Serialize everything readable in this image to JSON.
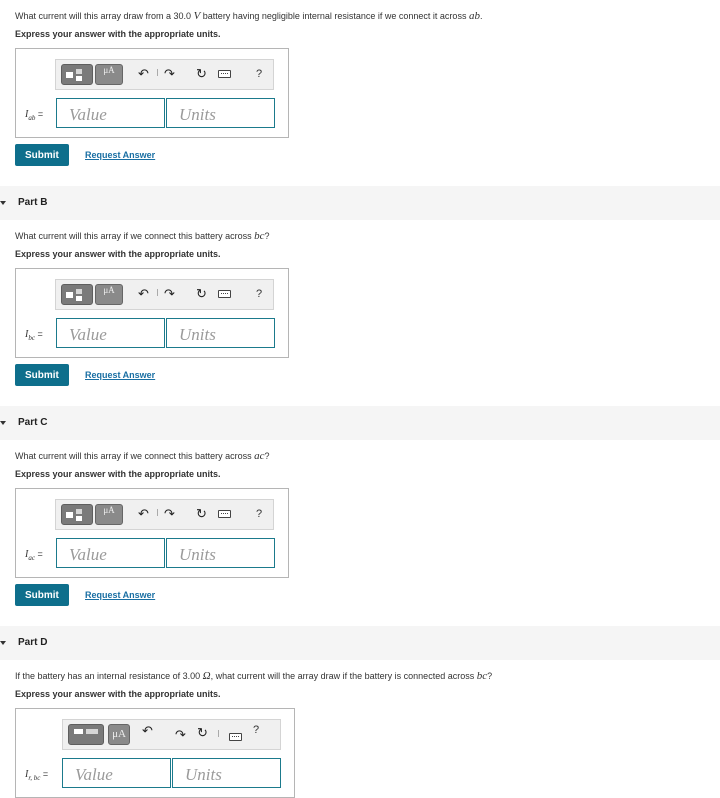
{
  "partA": {
    "question_pre": "What current will this array draw from a 30.0 ",
    "question_unit": "V",
    "question_post": " battery having negligible internal resistance if we connect it across ",
    "question_var": "ab",
    "question_end": ".",
    "instruction": "Express your answer with the appropriate units.",
    "label_main": "I",
    "label_sub": "ab",
    "label_eq": " =",
    "value_placeholder": "Value",
    "units_placeholder": "Units",
    "submit_label": "Submit",
    "request_label": "Request Answer"
  },
  "partB": {
    "header": "Part B",
    "question_pre": "What current will this array if we connect this battery across ",
    "question_var": "bc",
    "question_end": "?",
    "instruction": "Express your answer with the appropriate units.",
    "label_main": "I",
    "label_sub": "bc",
    "label_eq": " =",
    "value_placeholder": "Value",
    "units_placeholder": "Units",
    "submit_label": "Submit",
    "request_label": "Request Answer"
  },
  "partC": {
    "header": "Part C",
    "question_pre": "What current will this array if we connect this battery across ",
    "question_var": "ac",
    "question_end": "?",
    "instruction": "Express your answer with the appropriate units.",
    "label_main": "I",
    "label_sub": "ac",
    "label_eq": " =",
    "value_placeholder": "Value",
    "units_placeholder": "Units",
    "submit_label": "Submit",
    "request_label": "Request Answer"
  },
  "partD": {
    "header": "Part D",
    "question_pre": "If the battery has an internal resistance of 3.00 ",
    "question_unit": "Ω",
    "question_post": ", what current will the array draw if the battery is connected across ",
    "question_var": "bc",
    "question_end": "?",
    "instruction": "Express your answer with the appropriate units.",
    "label_main": "I",
    "label_sub": "r, bc",
    "label_eq": " =",
    "value_placeholder": "Value",
    "units_placeholder": "Units",
    "mu_label": "μA"
  },
  "toolbar": {
    "help": "?",
    "undo_icon": "undo-icon",
    "redo_icon": "redo-icon",
    "reset_icon": "reset-icon",
    "keyboard_icon": "keyboard-icon",
    "template_icon": "template-icon"
  },
  "colors": {
    "field_border": "#1b7a8c",
    "submit_bg": "#0e6f8c",
    "link": "#1a6fa3",
    "part_header_bg": "#f5f5f5"
  }
}
